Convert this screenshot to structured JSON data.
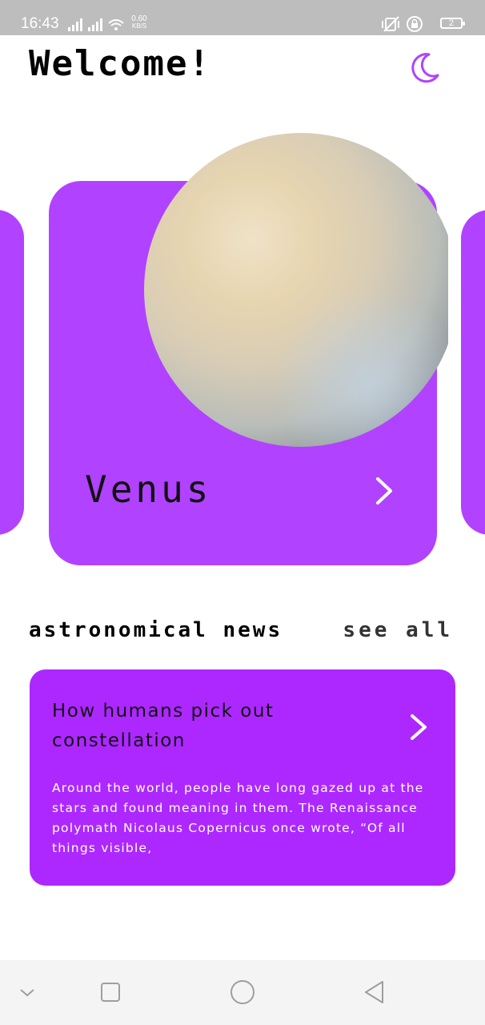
{
  "status_bar": {
    "time": "16:43",
    "net_speed_value": "0.60",
    "net_speed_unit": "KB/S",
    "battery_level": "2"
  },
  "header": {
    "title": "Welcome!",
    "theme_toggle_icon": "moon-icon"
  },
  "carousel": {
    "current_planet": "Venus",
    "arrow_icon": "chevron-right-icon"
  },
  "news": {
    "section_title": "astronomical news",
    "see_all_label": "see all",
    "article": {
      "headline": "How humans pick out constellation",
      "excerpt": " Around the world, people have long gazed up at the stars and found meaning in them. The Renaissance polymath Nicolaus Copernicus once wrote, “Of all things visible,"
    }
  },
  "nav_bar": {
    "buttons": [
      "chevron-down-icon",
      "recent-apps-icon",
      "home-icon",
      "back-icon"
    ]
  },
  "colors": {
    "accent": "#b142ff",
    "news_card": "#ad28ff",
    "status_bar": "#bdbdbd",
    "nav_bar": "#f4f4f4"
  }
}
